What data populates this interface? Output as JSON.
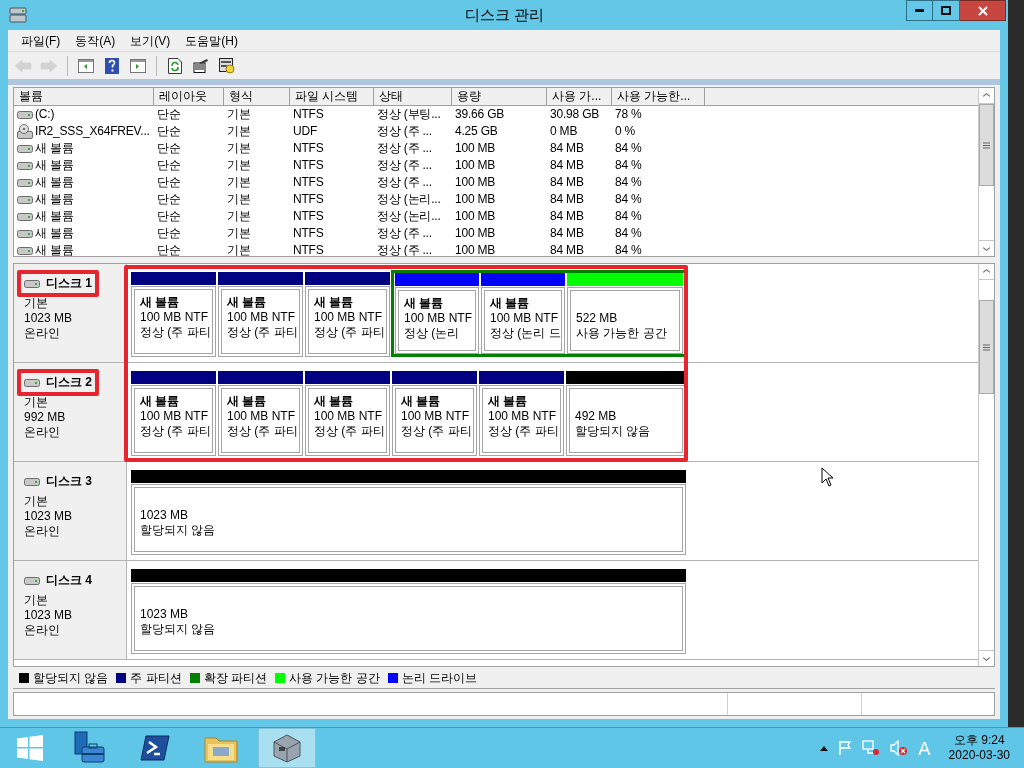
{
  "window": {
    "title": "디스크 관리"
  },
  "menu": [
    "파일(F)",
    "동작(A)",
    "보기(V)",
    "도움말(H)"
  ],
  "toolbar": [
    {
      "kind": "back",
      "disabled": true
    },
    {
      "kind": "forward",
      "disabled": true
    },
    {
      "kind": "separator"
    },
    {
      "kind": "pane",
      "disabled": false
    },
    {
      "kind": "help",
      "disabled": false
    },
    {
      "kind": "pane-action",
      "disabled": false
    },
    {
      "kind": "separator"
    },
    {
      "kind": "refresh",
      "disabled": false
    },
    {
      "kind": "properties",
      "disabled": false
    },
    {
      "kind": "settings",
      "disabled": false
    }
  ],
  "volumes": {
    "columns": [
      "볼륨",
      "레이아웃",
      "형식",
      "파일 시스템",
      "상태",
      "용량",
      "사용 가...",
      "사용 가능한..."
    ],
    "rows": [
      {
        "kind": "disk",
        "cells": [
          "(C:)",
          "단순",
          "기본",
          "NTFS",
          "정상 (부팅...",
          "39.66 GB",
          "30.98 GB",
          "78 %"
        ]
      },
      {
        "kind": "cd",
        "cells": [
          "IR2_SSS_X64FREV...",
          "단순",
          "기본",
          "UDF",
          "정상 (주 ...",
          "4.25 GB",
          "0 MB",
          "0 %"
        ]
      },
      {
        "kind": "disk",
        "cells": [
          "새 볼륨",
          "단순",
          "기본",
          "NTFS",
          "정상 (주 ...",
          "100 MB",
          "84 MB",
          "84 %"
        ]
      },
      {
        "kind": "disk",
        "cells": [
          "새 볼륨",
          "단순",
          "기본",
          "NTFS",
          "정상 (주 ...",
          "100 MB",
          "84 MB",
          "84 %"
        ]
      },
      {
        "kind": "disk",
        "cells": [
          "새 볼륨",
          "단순",
          "기본",
          "NTFS",
          "정상 (주 ...",
          "100 MB",
          "84 MB",
          "84 %"
        ]
      },
      {
        "kind": "disk",
        "cells": [
          "새 볼륨",
          "단순",
          "기본",
          "NTFS",
          "정상 (논리...",
          "100 MB",
          "84 MB",
          "84 %"
        ]
      },
      {
        "kind": "disk",
        "cells": [
          "새 볼륨",
          "단순",
          "기본",
          "NTFS",
          "정상 (논리...",
          "100 MB",
          "84 MB",
          "84 %"
        ]
      },
      {
        "kind": "disk",
        "cells": [
          "새 볼륨",
          "단순",
          "기본",
          "NTFS",
          "정상 (주 ...",
          "100 MB",
          "84 MB",
          "84 %"
        ]
      },
      {
        "kind": "disk",
        "cells": [
          "새 볼륨",
          "단순",
          "기본",
          "NTFS",
          "정상 (주 ...",
          "100 MB",
          "84 MB",
          "84 %"
        ]
      }
    ]
  },
  "disks": [
    {
      "name": "디스크 1",
      "type": "기본",
      "size": "1023 MB",
      "status": "온라인",
      "highlighted": true,
      "partitions": [
        {
          "kind": "primary",
          "name": "새 볼륨",
          "size": "100 MB NTF",
          "status": "정상 (주 파티"
        },
        {
          "kind": "primary",
          "name": "새 볼륨",
          "size": "100 MB NTF",
          "status": "정상 (주 파티"
        },
        {
          "kind": "primary",
          "name": "새 볼륨",
          "size": "100 MB NTF",
          "status": "정상 (주 파티"
        },
        {
          "kind": "extended",
          "children": [
            {
              "kind": "logical",
              "name": "새 볼륨",
              "size": "100 MB NTF",
              "status": "정상 (논리"
            },
            {
              "kind": "logical",
              "name": "새 볼륨",
              "size": "100 MB NTF",
              "status": "정상 (논리 드"
            },
            {
              "kind": "free",
              "size": "522 MB",
              "status": "사용 가능한 공간"
            }
          ]
        }
      ]
    },
    {
      "name": "디스크 2",
      "type": "기본",
      "size": "992 MB",
      "status": "온라인",
      "highlighted": true,
      "partitions": [
        {
          "kind": "primary",
          "name": "새 볼륨",
          "size": "100 MB NTF",
          "status": "정상 (주 파티"
        },
        {
          "kind": "primary",
          "name": "새 볼륨",
          "size": "100 MB NTF",
          "status": "정상 (주 파티"
        },
        {
          "kind": "primary",
          "name": "새 볼륨",
          "size": "100 MB NTF",
          "status": "정상 (주 파티"
        },
        {
          "kind": "primary",
          "name": "새 볼륨",
          "size": "100 MB NTF",
          "status": "정상 (주 파티"
        },
        {
          "kind": "primary",
          "name": "새 볼륨",
          "size": "100 MB NTF",
          "status": "정상 (주 파티"
        },
        {
          "kind": "unallocated",
          "size": "492 MB",
          "status": "할당되지 않음"
        }
      ]
    },
    {
      "name": "디스크 3",
      "type": "기본",
      "size": "1023 MB",
      "status": "온라인",
      "highlighted": false,
      "partitions": [
        {
          "kind": "unallocated",
          "size": "1023 MB",
          "status": "할당되지 않음"
        }
      ]
    },
    {
      "name": "디스크 4",
      "type": "기본",
      "size": "1023 MB",
      "status": "온라인",
      "highlighted": false,
      "partitions": [
        {
          "kind": "unallocated",
          "size": "1023 MB",
          "status": "할당되지 않음"
        }
      ]
    }
  ],
  "legend": [
    {
      "label": "할당되지 않음",
      "color": "#000000"
    },
    {
      "label": "주 파티션",
      "color": "#000080"
    },
    {
      "label": "확장 파티션",
      "color": "#008000"
    },
    {
      "label": "사용 가능한 공간",
      "color": "#00ff00"
    },
    {
      "label": "논리 드라이브",
      "color": "#0000ff"
    }
  ],
  "taskbar": {
    "items": [
      {
        "kind": "start",
        "selected": false
      },
      {
        "kind": "server-manager",
        "selected": false
      },
      {
        "kind": "powershell",
        "selected": false
      },
      {
        "kind": "explorer",
        "selected": false
      },
      {
        "kind": "disk-management",
        "selected": true
      }
    ],
    "ime": "A",
    "time": "오후 9:24",
    "date": "2020-03-30"
  }
}
